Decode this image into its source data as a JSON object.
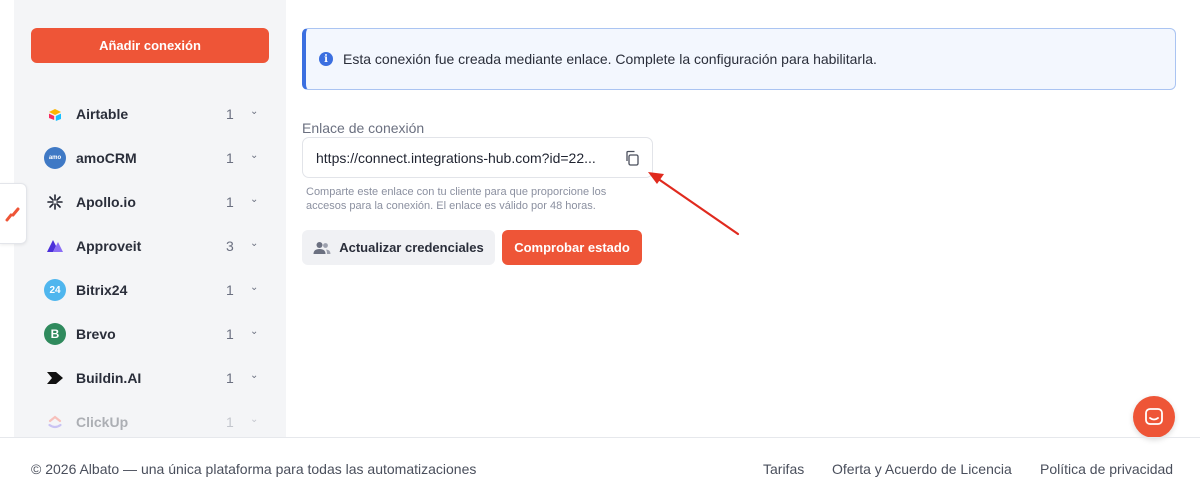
{
  "sidebar": {
    "add_button_label": "Añadir conexión",
    "apps": [
      {
        "name": "Airtable",
        "count": "1",
        "icon": "airtable-logo-icon",
        "color": "#f8f8f8"
      },
      {
        "name": "amoCRM",
        "count": "1",
        "icon": "amocrm-logo-icon",
        "color": "#3f79c5"
      },
      {
        "name": "Apollo.io",
        "count": "1",
        "icon": "apollo-logo-icon",
        "color": "#f4f5f7"
      },
      {
        "name": "Approveit",
        "count": "3",
        "icon": "approveit-logo-icon",
        "color": "#6a4cf0"
      },
      {
        "name": "Bitrix24",
        "count": "1",
        "icon": "bitrix24-logo-icon",
        "color": "#4fb6ee"
      },
      {
        "name": "Brevo",
        "count": "1",
        "icon": "brevo-logo-icon",
        "color": "#2f8a5d"
      },
      {
        "name": "Buildin.AI",
        "count": "1",
        "icon": "buildin-logo-icon",
        "color": "#111111"
      },
      {
        "name": "ClickUp",
        "count": "1",
        "icon": "clickup-logo-icon",
        "color": "#e8508b"
      }
    ],
    "amocrm_icon_text": "amo",
    "bitrix_icon_text": "24",
    "brevo_icon_text": "B"
  },
  "banner": {
    "text": "Esta conexión fue creada mediante enlace. Complete la configuración para habilitarla.",
    "icon_text": "i"
  },
  "link_field": {
    "label": "Enlace de conexión",
    "value": "https://connect.integrations-hub.com?id=22...",
    "hint": "Comparte este enlace con tu cliente para que proporcione los accesos para la conexión. El enlace es válido por 48 horas."
  },
  "actions": {
    "update_credentials_label": "Actualizar credenciales",
    "check_status_label": "Comprobar estado"
  },
  "footer": {
    "copyright": "© 2026 Albato — una única plataforma para todas las automatizaciones",
    "links": [
      "Tarifas",
      "Oferta y Acuerdo de Licencia",
      "Política de privacidad"
    ]
  },
  "colors": {
    "accent": "#ee5537",
    "info": "#3b6fe0"
  }
}
